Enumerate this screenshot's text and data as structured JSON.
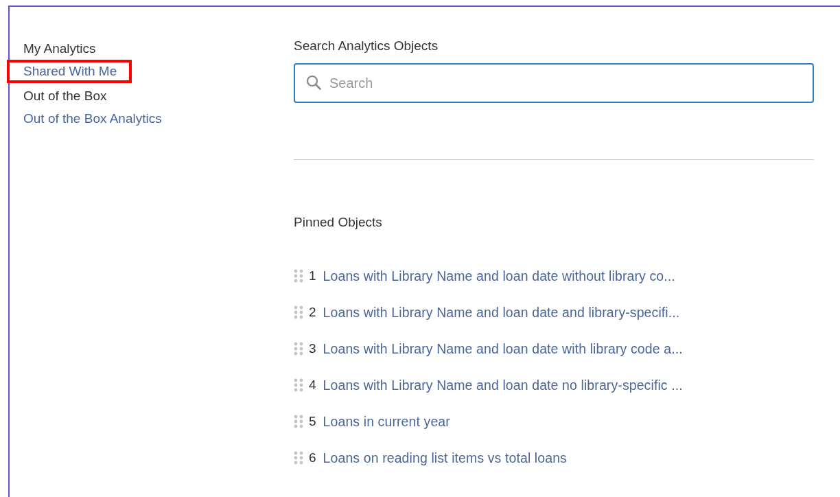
{
  "sidebar": {
    "sections": [
      {
        "title": "My Analytics",
        "items": [
          {
            "label": "Shared With Me",
            "highlighted": true
          }
        ]
      },
      {
        "title": "Out of the Box",
        "items": [
          {
            "label": "Out of the Box Analytics",
            "highlighted": false
          }
        ]
      }
    ]
  },
  "search": {
    "label": "Search Analytics Objects",
    "placeholder": "Search"
  },
  "pinned": {
    "title": "Pinned Objects",
    "items": [
      {
        "number": "1",
        "label": "Loans with Library Name and loan date without library co..."
      },
      {
        "number": "2",
        "label": "Loans with Library Name and loan date and library-specifi..."
      },
      {
        "number": "3",
        "label": "Loans with Library Name and loan date with library code a..."
      },
      {
        "number": "4",
        "label": "Loans with Library Name and loan date no library-specific ..."
      },
      {
        "number": "5",
        "label": "Loans in current year"
      },
      {
        "number": "6",
        "label": "Loans on reading list items vs total loans"
      }
    ]
  }
}
